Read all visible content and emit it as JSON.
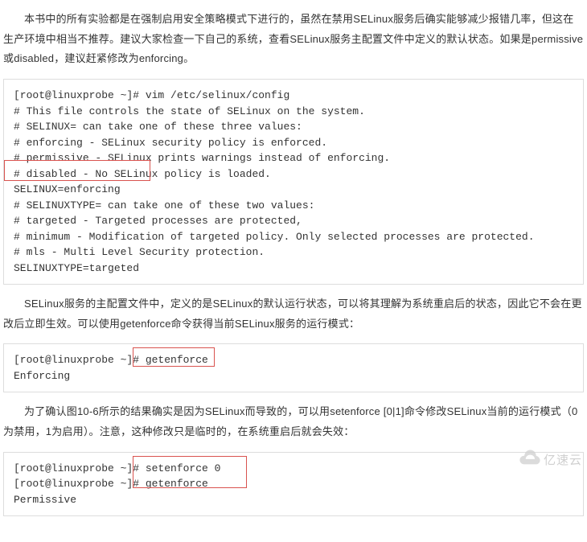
{
  "intro": "本书中的所有实验都是在强制启用安全策略模式下进行的，虽然在禁用SELinux服务后确实能够减少报错几率，但这在生产环境中相当不推荐。建议大家检查一下自己的系统，查看SELinux服务主配置文件中定义的默认状态。如果是permissive或disabled，建议赶紧修改为enforcing。",
  "code1": "[root@linuxprobe ~]# vim /etc/selinux/config\n# This file controls the state of SELinux on the system.\n# SELINUX= can take one of these three values:\n# enforcing - SELinux security policy is enforced.\n# permissive - SELinux prints warnings instead of enforcing.\n# disabled - No SELinux policy is loaded.\nSELINUX=enforcing\n# SELINUXTYPE= can take one of these two values:\n# targeted - Targeted processes are protected,\n# minimum - Modification of targeted policy. Only selected processes are protected.\n# mls - Multi Level Security protection.\nSELINUXTYPE=targeted",
  "middle1": "SELinux服务的主配置文件中，定义的是SELinux的默认运行状态，可以将其理解为系统重启后的状态，因此它不会在更改后立即生效。可以使用getenforce命令获得当前SELinux服务的运行模式：",
  "code2": "[root@linuxprobe ~]# getenforce\nEnforcing",
  "middle2": "为了确认图10-6所示的结果确实是因为SELinux而导致的，可以用setenforce [0|1]命令修改SELinux当前的运行模式（0为禁用，1为启用）。注意，这种修改只是临时的，在系统重启后就会失效：",
  "code3": "[root@linuxprobe ~]# setenforce 0\n[root@linuxprobe ~]# getenforce\nPermissive",
  "watermark_text": "亿速云"
}
